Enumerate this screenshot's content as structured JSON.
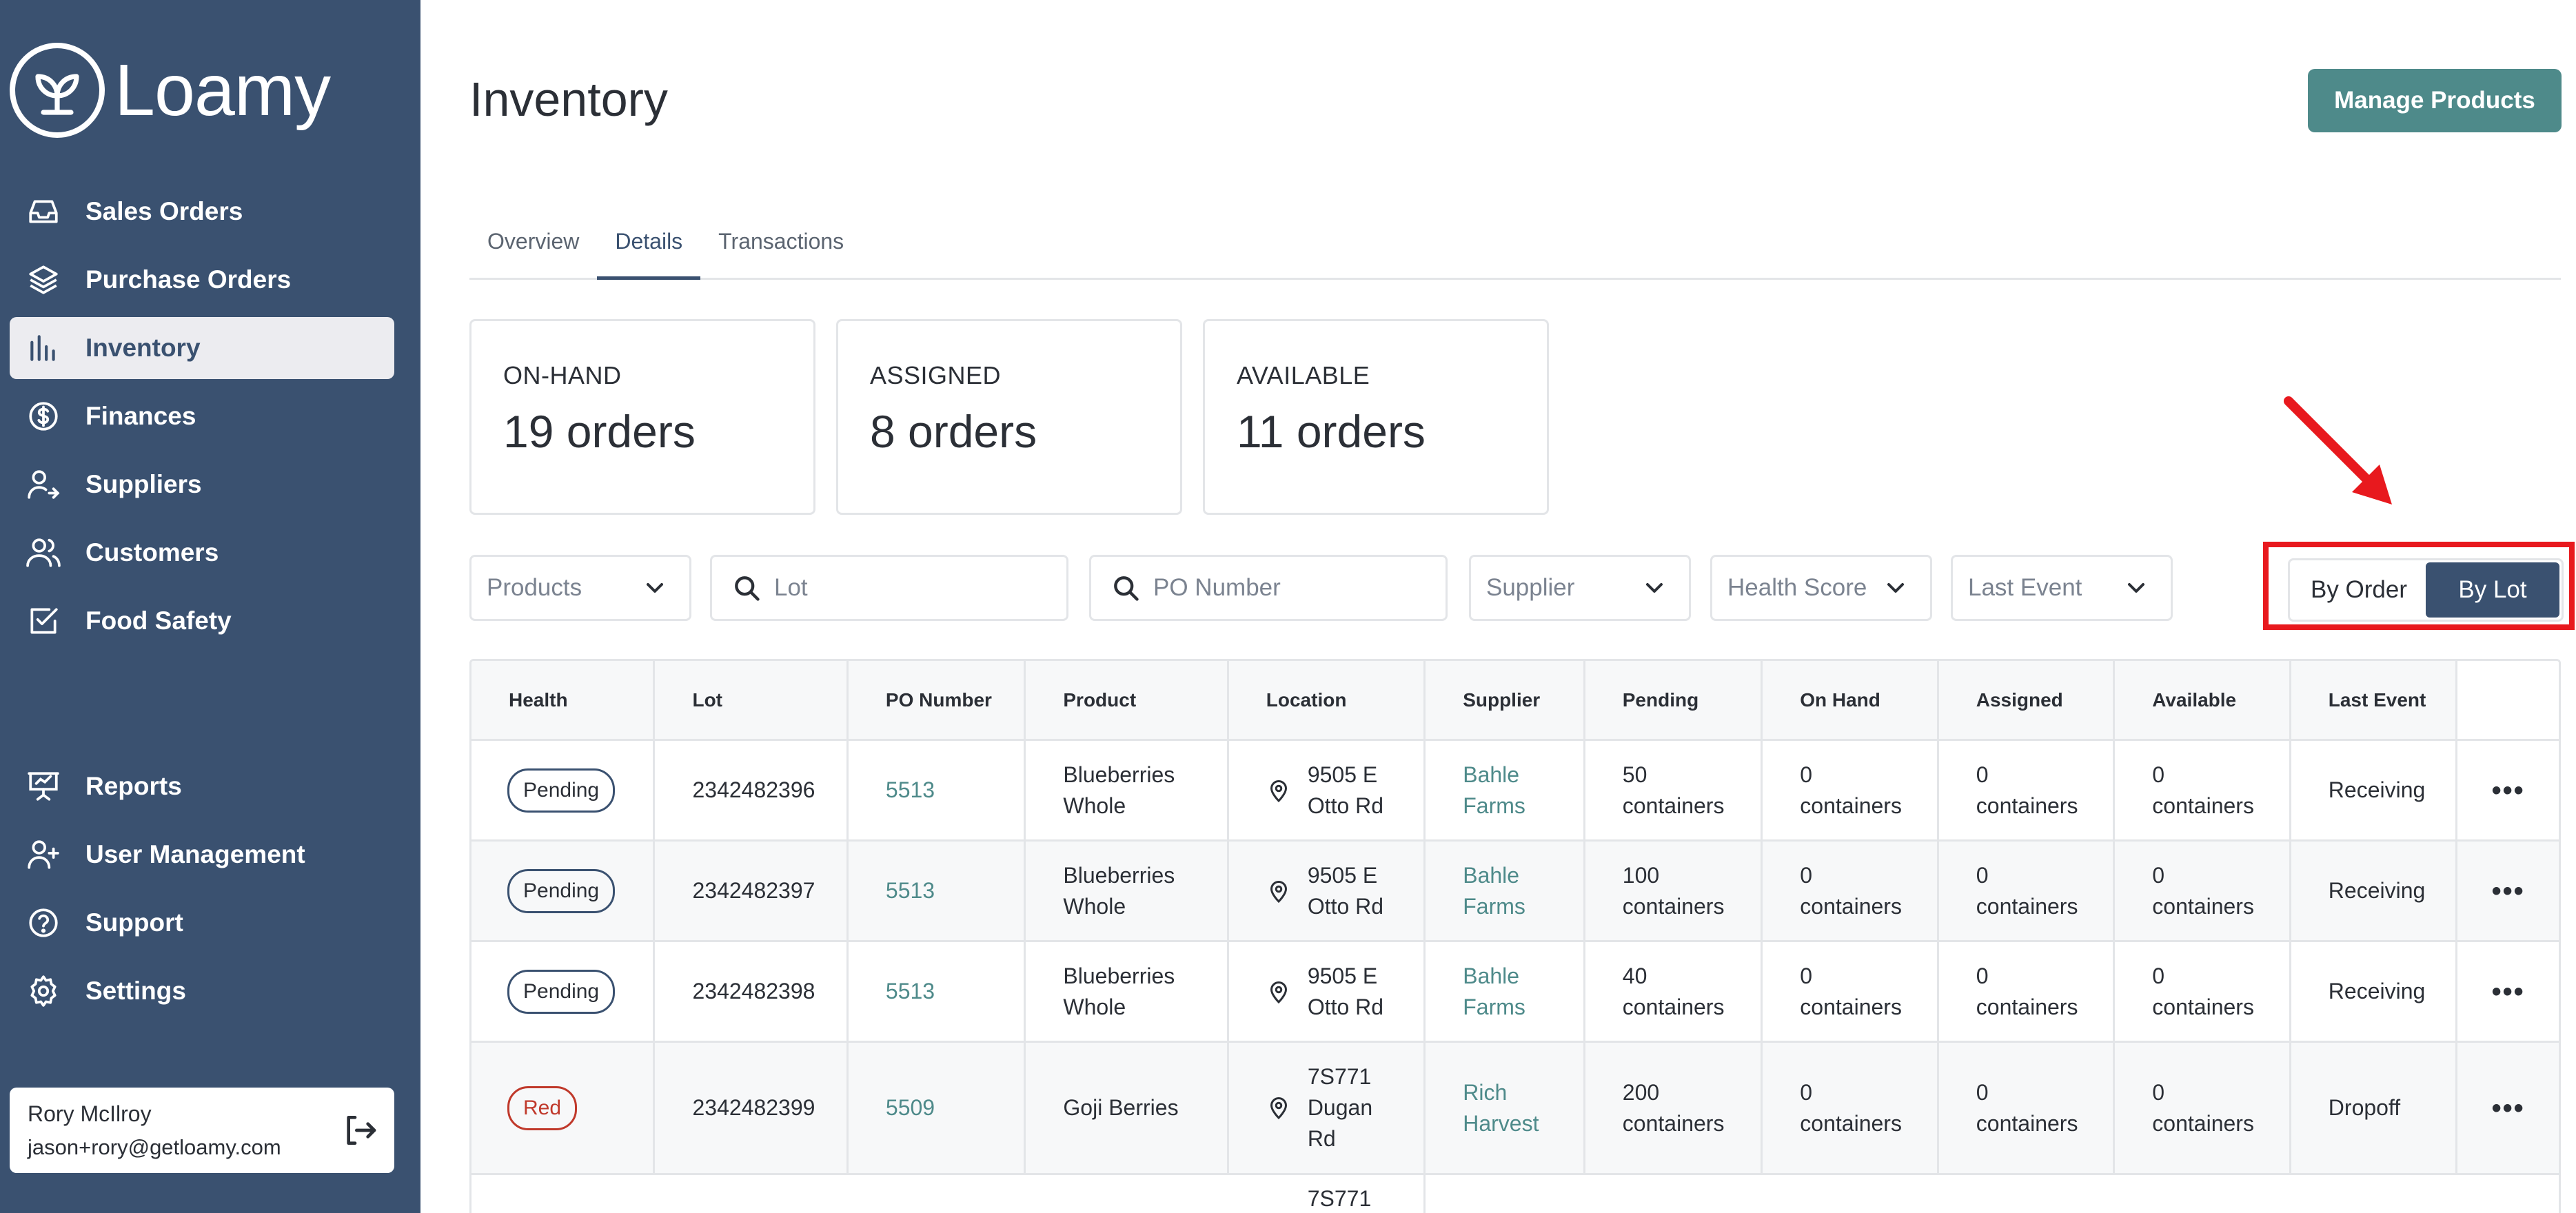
{
  "brand": {
    "name": "Loamy"
  },
  "sidebar": {
    "items": [
      {
        "label": "Sales Orders",
        "icon": "inbox-icon"
      },
      {
        "label": "Purchase Orders",
        "icon": "layers-icon"
      },
      {
        "label": "Inventory",
        "icon": "bar-chart-icon",
        "active": true
      },
      {
        "label": "Finances",
        "icon": "dollar-circle-icon"
      },
      {
        "label": "Suppliers",
        "icon": "user-arrow-icon"
      },
      {
        "label": "Customers",
        "icon": "users-icon"
      },
      {
        "label": "Food Safety",
        "icon": "check-square-icon"
      }
    ],
    "bottom_items": [
      {
        "label": "Reports",
        "icon": "presentation-icon"
      },
      {
        "label": "User Management",
        "icon": "user-plus-icon"
      },
      {
        "label": "Support",
        "icon": "help-circle-icon"
      },
      {
        "label": "Settings",
        "icon": "gear-icon"
      }
    ],
    "user": {
      "name": "Rory McIlroy",
      "email": "jason+rory@getloamy.com"
    }
  },
  "header": {
    "title": "Inventory",
    "manage_label": "Manage Products"
  },
  "tabs": [
    "Overview",
    "Details",
    "Transactions"
  ],
  "cards": [
    {
      "label": "ON-HAND",
      "value": "19 orders"
    },
    {
      "label": "ASSIGNED",
      "value": "8 orders"
    },
    {
      "label": "AVAILABLE",
      "value": "11 orders"
    }
  ],
  "filters": {
    "products": "Products",
    "lot_placeholder": "Lot",
    "po_placeholder": "PO Number",
    "supplier": "Supplier",
    "health": "Health Score",
    "last_event": "Last Event"
  },
  "view_toggle": {
    "by_order": "By Order",
    "by_lot": "By Lot",
    "selected": "By Lot"
  },
  "table": {
    "columns": [
      "Health",
      "Lot",
      "PO Number",
      "Product",
      "Location",
      "Supplier",
      "Pending",
      "On Hand",
      "Assigned",
      "Available",
      "Last Event"
    ],
    "rows": [
      {
        "health": "Pending",
        "lot": "2342482396",
        "po": "5513",
        "product_1": "Blueberries",
        "product_2": "Whole",
        "loc_1": "9505 E",
        "loc_2": "Otto Rd",
        "supplier_1": "Bahle",
        "supplier_2": "Farms",
        "pending_1": "50",
        "onhand_1": "0",
        "assigned_1": "0",
        "available_1": "0",
        "unit": "containers",
        "event": "Receiving"
      },
      {
        "health": "Pending",
        "lot": "2342482397",
        "po": "5513",
        "product_1": "Blueberries",
        "product_2": "Whole",
        "loc_1": "9505 E",
        "loc_2": "Otto Rd",
        "supplier_1": "Bahle",
        "supplier_2": "Farms",
        "pending_1": "100",
        "onhand_1": "0",
        "assigned_1": "0",
        "available_1": "0",
        "unit": "containers",
        "event": "Receiving"
      },
      {
        "health": "Pending",
        "lot": "2342482398",
        "po": "5513",
        "product_1": "Blueberries",
        "product_2": "Whole",
        "loc_1": "9505 E",
        "loc_2": "Otto Rd",
        "supplier_1": "Bahle",
        "supplier_2": "Farms",
        "pending_1": "40",
        "onhand_1": "0",
        "assigned_1": "0",
        "available_1": "0",
        "unit": "containers",
        "event": "Receiving"
      },
      {
        "health": "Red",
        "lot": "2342482399",
        "po": "5509",
        "product_1": "Goji Berries",
        "loc_1": "7S771",
        "loc_2": "Dugan",
        "loc_3": "Rd",
        "supplier_1": "Rich",
        "supplier_2": "Harvest",
        "pending_1": "200",
        "onhand_1": "0",
        "assigned_1": "0",
        "available_1": "0",
        "unit": "containers",
        "event": "Dropoff"
      },
      {
        "loc_1": "7S771"
      }
    ]
  }
}
